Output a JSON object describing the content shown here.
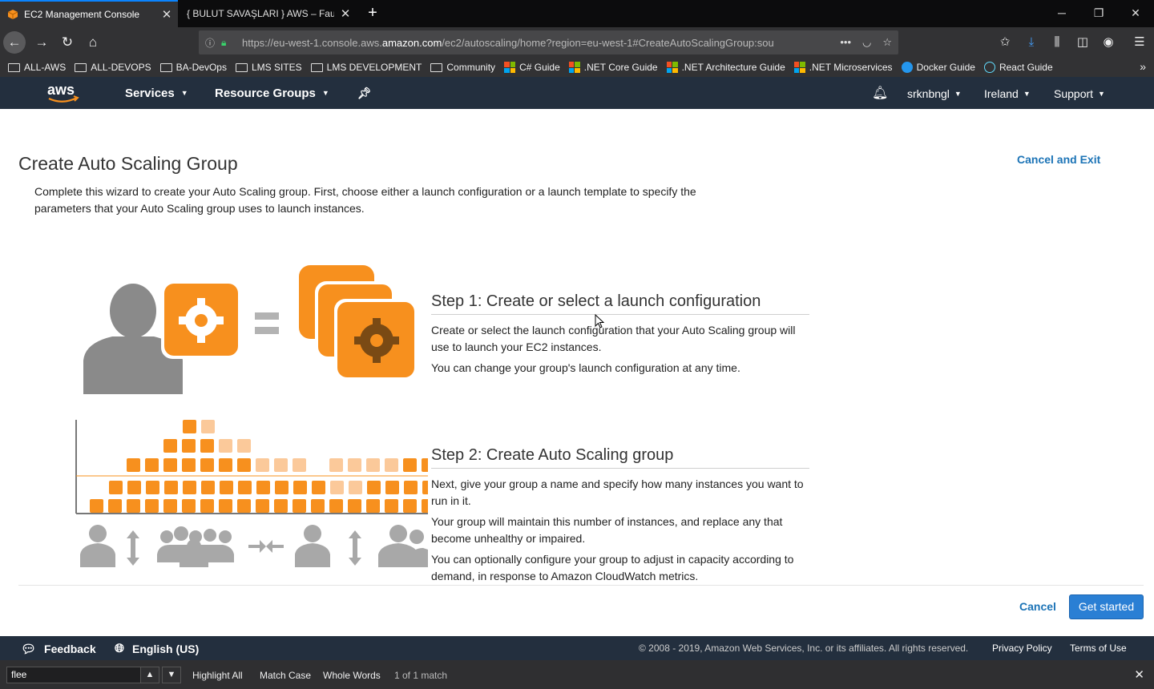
{
  "browser": {
    "tabs": [
      {
        "title": "EC2 Management Console",
        "active": true
      },
      {
        "title": "{ BULUT SAVAŞLARI } AWS – Fault Te",
        "active": false
      }
    ],
    "url_prefix": "https://eu-west-1.console.aws.",
    "url_domain": "amazon.com",
    "url_suffix": "/ec2/autoscaling/home?region=eu-west-1#CreateAutoScalingGroup:sou",
    "bookmarks": [
      {
        "label": "ALL-AWS",
        "icon": "folder-icon"
      },
      {
        "label": "ALL-DEVOPS",
        "icon": "folder-icon"
      },
      {
        "label": "BA-DevOps",
        "icon": "folder-icon"
      },
      {
        "label": "LMS SITES",
        "icon": "folder-icon"
      },
      {
        "label": "LMS DEVELOPMENT",
        "icon": "folder-icon"
      },
      {
        "label": "Community",
        "icon": "folder-icon"
      },
      {
        "label": "C# Guide",
        "icon": "microsoft-icon"
      },
      {
        "label": ".NET Core Guide",
        "icon": "microsoft-icon"
      },
      {
        "label": ".NET Architecture Guide",
        "icon": "microsoft-icon"
      },
      {
        "label": ".NET Microservices",
        "icon": "microsoft-icon"
      },
      {
        "label": "Docker Guide",
        "icon": "docker-icon"
      },
      {
        "label": "React Guide",
        "icon": "react-icon"
      }
    ]
  },
  "aws_header": {
    "services": "Services",
    "resource_groups": "Resource Groups",
    "user": "srknbngl",
    "region": "Ireland",
    "support": "Support"
  },
  "page": {
    "title": "Create Auto Scaling Group",
    "cancel_exit": "Cancel and Exit",
    "intro": "Complete this wizard to create your Auto Scaling group. First, choose either a launch configuration or a launch template to specify the parameters that your Auto Scaling group uses to launch instances.",
    "step1": {
      "heading": "Step 1: Create or select a launch configuration",
      "p1": "Create or select the launch configuration that your Auto Scaling group will use to launch your EC2 instances.",
      "p2": "You can change your group's launch configuration at any time."
    },
    "step2": {
      "heading": "Step 2: Create Auto Scaling group",
      "p1": "Next, give your group a name and specify how many instances you want to run in it.",
      "p2": "Your group will maintain this number of instances, and replace any that become unhealthy or impaired.",
      "p3": "You can optionally configure your group to adjust in capacity according to demand, in response to Amazon CloudWatch metrics."
    },
    "cancel": "Cancel",
    "get_started": "Get started"
  },
  "footer": {
    "feedback": "Feedback",
    "language": "English (US)",
    "copyright": "© 2008 - 2019, Amazon Web Services, Inc. or its affiliates. All rights reserved.",
    "privacy": "Privacy Policy",
    "terms": "Terms of Use"
  },
  "findbar": {
    "query": "flee",
    "highlight_all": "Highlight All",
    "match_case": "Match Case",
    "whole_words": "Whole Words",
    "result": "1 of 1 match"
  },
  "colors": {
    "aws_orange": "#f7901e",
    "aws_navy": "#232f3e",
    "link_blue": "#1b73b6",
    "button_blue": "#2a7fd4"
  }
}
